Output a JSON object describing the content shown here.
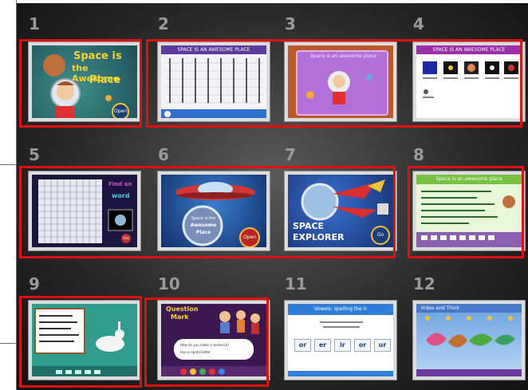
{
  "slides": [
    {
      "number": "1",
      "title_line1": "Space is",
      "title_line2": "the Awesome",
      "title_line3": "Place",
      "button": "Open"
    },
    {
      "number": "2",
      "header": "SPACE IS AN AWESOME PLACE"
    },
    {
      "number": "3",
      "title": "Space is an awesome place"
    },
    {
      "number": "4",
      "header": "SPACE IS AN AWESOME PLACE"
    },
    {
      "number": "5",
      "side_text_1": "Find an",
      "side_text_2": "word",
      "button": "Go"
    },
    {
      "number": "6",
      "circle_text_1": "Space is the",
      "circle_text_2": "Awesome",
      "circle_text_3": "Place",
      "button": "Open"
    },
    {
      "number": "7",
      "title_line1": "SPACE",
      "title_line2": "EXPLORER",
      "button": "Go"
    },
    {
      "number": "8",
      "header": "Space is an awesome place"
    },
    {
      "number": "9"
    },
    {
      "number": "10",
      "title_line1": "Question",
      "title_line2": "Mark",
      "question": "How do you make a sentence?",
      "answer": "Use a capital letter."
    },
    {
      "number": "11",
      "header": "Vowels: spelling the ir",
      "choices": [
        "or",
        "er",
        "ir",
        "or",
        "ur"
      ]
    },
    {
      "number": "12",
      "header": "Index and Think"
    }
  ],
  "colors": {
    "highlight": "#e01010",
    "background": "#2a2a2a"
  }
}
